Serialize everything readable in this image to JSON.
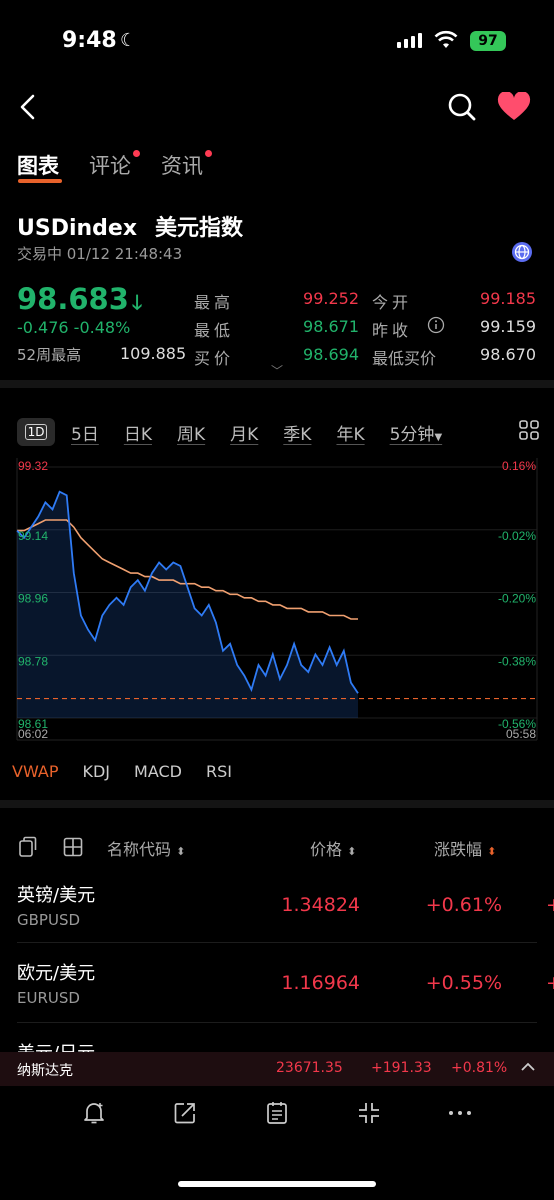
{
  "status": {
    "time": "9:48",
    "battery": "97"
  },
  "tabs": [
    {
      "label": "图表",
      "active": true,
      "dot": false
    },
    {
      "label": "评论",
      "active": false,
      "dot": true
    },
    {
      "label": "资讯",
      "active": false,
      "dot": true
    }
  ],
  "instrument": {
    "symbol": "USDindex",
    "name_cn": "美元指数",
    "status_line": "交易中 01/12 21:48:43",
    "price": "98.683",
    "change": "-0.476",
    "change_pct": "-0.48%",
    "hi52_label": "52周最高",
    "hi52_value": "109.885"
  },
  "quote": {
    "high_label": "最高",
    "high": "99.252",
    "low_label": "最低",
    "low": "98.671",
    "bid_label": "买价",
    "bid": "98.694",
    "open_label": "今开",
    "open": "99.185",
    "prev_label": "昨收",
    "prev": "99.159",
    "lowbid_label": "最低买价",
    "lowbid": "98.670"
  },
  "periods": [
    "1D",
    "5日",
    "日K",
    "周K",
    "月K",
    "季K",
    "年K",
    "5分钟"
  ],
  "chart_data": {
    "type": "line",
    "x_start": "06:02",
    "x_end": "05:58",
    "y_ticks": [
      "99.32",
      "99.14",
      "98.96",
      "98.78",
      "98.61"
    ],
    "pct_ticks": [
      "0.16%",
      "-0.02%",
      "-0.20%",
      "-0.38%",
      "-0.56%"
    ],
    "ylim": [
      98.61,
      99.32
    ],
    "series": [
      {
        "values": [
          99.14,
          99.12,
          99.15,
          99.18,
          99.22,
          99.2,
          99.25,
          99.24,
          99.02,
          98.9,
          98.86,
          98.83,
          98.9,
          98.93,
          98.95,
          98.93,
          98.98,
          99.0,
          98.97,
          99.02,
          99.05,
          99.03,
          99.05,
          99.04,
          98.98,
          98.92,
          98.9,
          98.93,
          98.88,
          98.8,
          98.82,
          98.76,
          98.73,
          98.69,
          98.76,
          98.73,
          98.79,
          98.72,
          98.76,
          98.82,
          98.76,
          98.74,
          98.79,
          98.76,
          98.81,
          98.76,
          98.8,
          98.71,
          98.68
        ]
      },
      {
        "values": [
          99.14,
          99.14,
          99.15,
          99.16,
          99.17,
          99.17,
          99.17,
          99.17,
          99.15,
          99.12,
          99.1,
          99.08,
          99.06,
          99.05,
          99.04,
          99.03,
          99.02,
          99.02,
          99.01,
          99.01,
          99.0,
          99.0,
          99.0,
          98.99,
          98.99,
          98.99,
          98.98,
          98.98,
          98.97,
          98.97,
          98.96,
          98.96,
          98.95,
          98.95,
          98.94,
          98.94,
          98.93,
          98.93,
          98.92,
          98.92,
          98.92,
          98.91,
          98.91,
          98.91,
          98.9,
          98.9,
          98.9,
          98.89,
          98.89
        ]
      }
    ],
    "reference_line": 98.665,
    "colors": {
      "price": "#2f7bf5",
      "vwap": "#f0a070",
      "reference": "#e8622b"
    }
  },
  "indicators": [
    "VWAP",
    "KDJ",
    "MACD",
    "RSI"
  ],
  "list": {
    "header": {
      "name": "名称代码",
      "price": "价格",
      "pct": "涨跌幅"
    },
    "rows": [
      {
        "name": "英镑/美元",
        "code": "GBPUSD",
        "price": "1.34824",
        "pct": "+0.61%"
      },
      {
        "name": "欧元/美元",
        "code": "EURUSD",
        "price": "1.16964",
        "pct": "+0.55%"
      },
      {
        "name": "美元/日元",
        "code": "",
        "price": "",
        "pct": ""
      }
    ]
  },
  "ticker": {
    "name": "纳斯达克",
    "value": "23671.35",
    "change": "+191.33",
    "pct": "+0.81%"
  }
}
